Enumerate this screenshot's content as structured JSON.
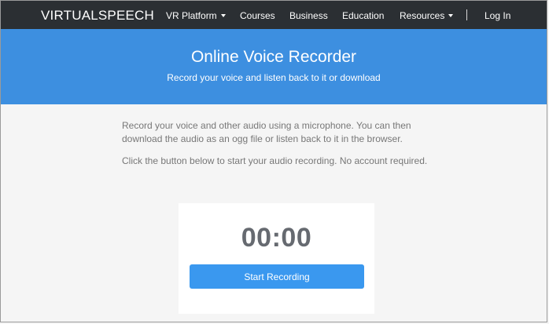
{
  "navbar": {
    "brand": "VIRTUALSPEECH",
    "items": [
      {
        "label": "VR Platform",
        "dropdown": true
      },
      {
        "label": "Courses"
      },
      {
        "label": "Business"
      },
      {
        "label": "Education"
      },
      {
        "label": "Resources",
        "dropdown": true
      }
    ],
    "login": "Log In"
  },
  "hero": {
    "title": "Online Voice Recorder",
    "subtitle": "Record your voice and listen back to it or download"
  },
  "content": {
    "paragraph1": "Record your voice and other audio using a microphone. You can then download the audio as an ogg file or listen back to it in the browser.",
    "paragraph2": "Click the button below to start your audio recording. No account required."
  },
  "recorder": {
    "timer": "00:00",
    "start_label": "Start Recording"
  },
  "colors": {
    "navbar_bg": "#2b2f33",
    "hero_bg": "#3d8fe0",
    "button_bg": "#3a98ef",
    "page_bg": "#f5f5f5"
  }
}
